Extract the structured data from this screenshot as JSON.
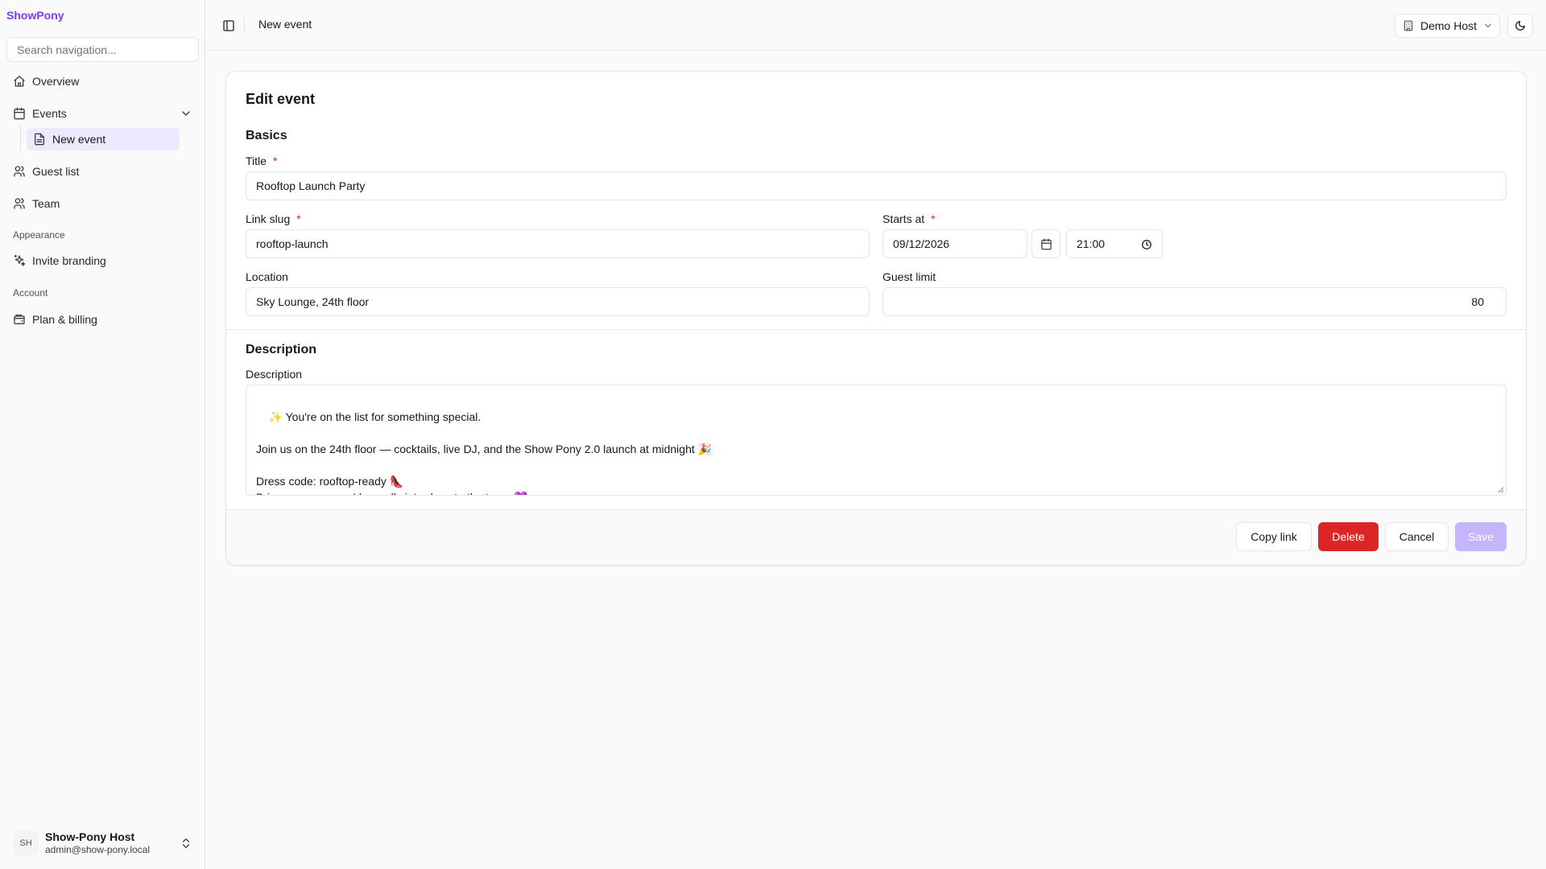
{
  "app": {
    "brand": "ShowPony"
  },
  "sidebar": {
    "search_placeholder": "Search navigation...",
    "items": [
      {
        "label": "Overview",
        "icon": "home-icon"
      },
      {
        "label": "Events",
        "icon": "calendar-icon"
      },
      {
        "label": "Guest list",
        "icon": "users-icon"
      },
      {
        "label": "Team",
        "icon": "users-icon"
      },
      {
        "label": "Invite branding",
        "icon": "sparkles-icon"
      },
      {
        "label": "Plan & billing",
        "icon": "wallet-icon"
      }
    ],
    "sub_item": {
      "label": "New event",
      "icon": "file-icon"
    },
    "groups": {
      "appearance": "Appearance",
      "account": "Account"
    },
    "user": {
      "initials": "SH",
      "name": "Show-Pony Host",
      "email": "admin@show-pony.local"
    }
  },
  "header": {
    "breadcrumb": "New event",
    "org": "Demo Host"
  },
  "form": {
    "card_title": "Edit event",
    "basics_title": "Basics",
    "title_label": "Title",
    "title_value": "Rooftop Launch Party",
    "slug_label": "Link slug",
    "slug_value": "rooftop-launch",
    "starts_label": "Starts at",
    "date_value": "09/12/2026",
    "time_value": "21:00",
    "location_label": "Location",
    "location_value": "Sky Lounge, 24th floor",
    "guest_limit_label": "Guest limit",
    "guest_limit_value": "80",
    "required_mark": "*",
    "description_section": "Description",
    "description_label": "Description",
    "description_value": "✨ You're on the list for something special.\n\nJoin us on the 24th floor — cocktails, live DJ, and the Show Pony 2.0 launch at midnight 🎉\n\nDress code: rooftop-ready 👠\nBring someone you'd proudly introduce to the team 💜"
  },
  "actions": {
    "copy_link": "Copy link",
    "delete": "Delete",
    "cancel": "Cancel",
    "save": "Save"
  },
  "colors": {
    "brand": "#7c3aed",
    "danger": "#dc2626",
    "primary_disabled": "#c4b5fd",
    "active_nav": "#ede9fe"
  }
}
